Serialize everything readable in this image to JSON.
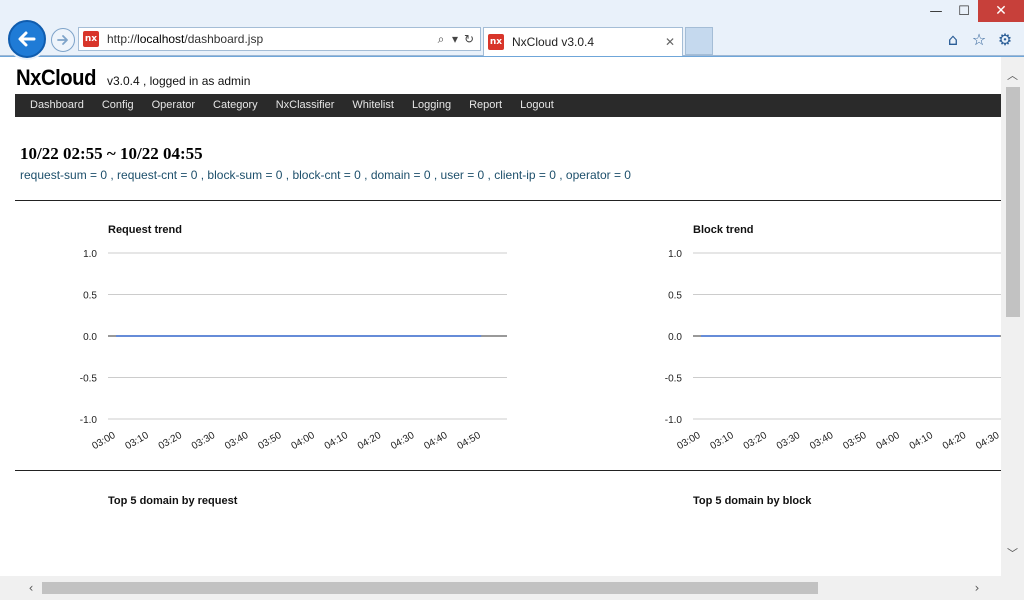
{
  "browser": {
    "url_prefix": "http://",
    "url_host": "localhost",
    "url_path": "/dashboard.jsp",
    "favicon_text": "nx",
    "tab_title": "NxCloud v3.0.4",
    "window_controls": {
      "minimize": "—",
      "maximize": "☐",
      "close": "✕"
    },
    "icons": [
      "home-icon",
      "star-icon",
      "gear-icon"
    ]
  },
  "app": {
    "logo": "NxCloud",
    "status": "v3.0.4 , logged in as admin",
    "nav": [
      "Dashboard",
      "Config",
      "Operator",
      "Category",
      "NxClassifier",
      "Whitelist",
      "Logging",
      "Report",
      "Logout"
    ]
  },
  "dashboard": {
    "period": "10/22 02:55 ~ 10/22 04:55",
    "stats": "request-sum = 0 , request-cnt = 0 , block-sum = 0 , block-cnt = 0 , domain = 0 , user = 0 , client-ip = 0 , operator = 0",
    "sections": {
      "top_request_title": "Top 5 domain by request",
      "top_block_title": "Top 5 domain by block"
    }
  },
  "chart_data": [
    {
      "type": "line",
      "title": "Request trend",
      "x": [
        "03:00",
        "03:10",
        "03:20",
        "03:30",
        "03:40",
        "03:50",
        "04:00",
        "04:10",
        "04:20",
        "04:30",
        "04:40",
        "04:50"
      ],
      "series": [
        {
          "values": [
            0,
            0,
            0,
            0,
            0,
            0,
            0,
            0,
            0,
            0,
            0,
            0
          ],
          "color": "#3366cc"
        }
      ],
      "y_ticks": [
        "1.0",
        "0.5",
        "0.0",
        "-0.5",
        "-1.0"
      ],
      "ylim": [
        -1,
        1
      ],
      "grid": true
    },
    {
      "type": "line",
      "title": "Block trend",
      "x": [
        "03:00",
        "03:10",
        "03:20",
        "03:30",
        "03:40",
        "03:50",
        "04:00",
        "04:10",
        "04:20",
        "04:30"
      ],
      "series": [
        {
          "values": [
            0,
            0,
            0,
            0,
            0,
            0,
            0,
            0,
            0,
            0
          ],
          "color": "#3366cc"
        }
      ],
      "y_ticks": [
        "1.0",
        "0.5",
        "0.0",
        "-0.5",
        "-1.0"
      ],
      "ylim": [
        -1,
        1
      ],
      "grid": true
    }
  ]
}
